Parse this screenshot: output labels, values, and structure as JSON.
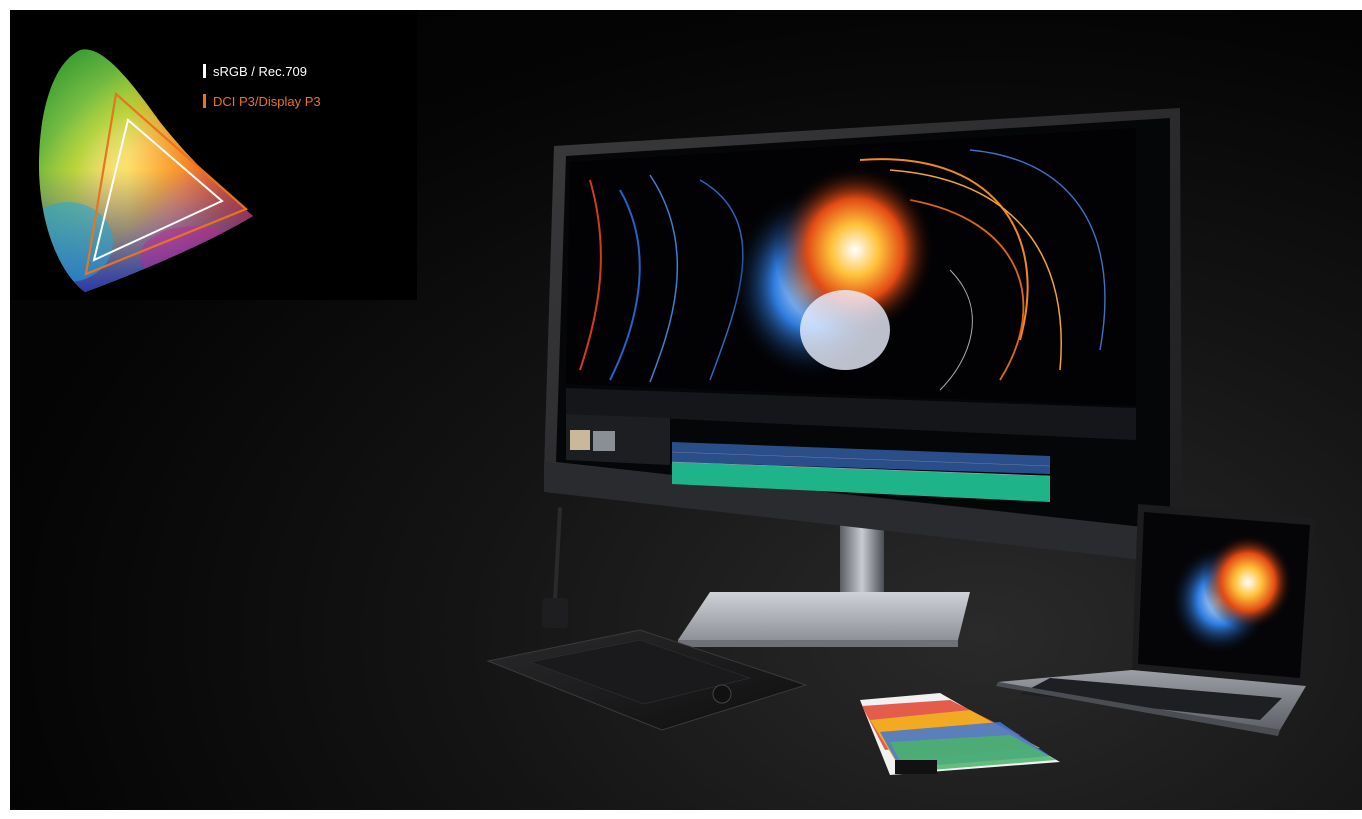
{
  "gamut_legend": {
    "srgb": {
      "label": "sRGB / Rec.709",
      "color": "#ffffff"
    },
    "p3": {
      "label": "DCI P3/Display P3",
      "color": "#e8741e"
    }
  },
  "colors": {
    "background": "#000000",
    "accent_orange": "#e8741e",
    "timeline_green": "#1fb38a"
  }
}
